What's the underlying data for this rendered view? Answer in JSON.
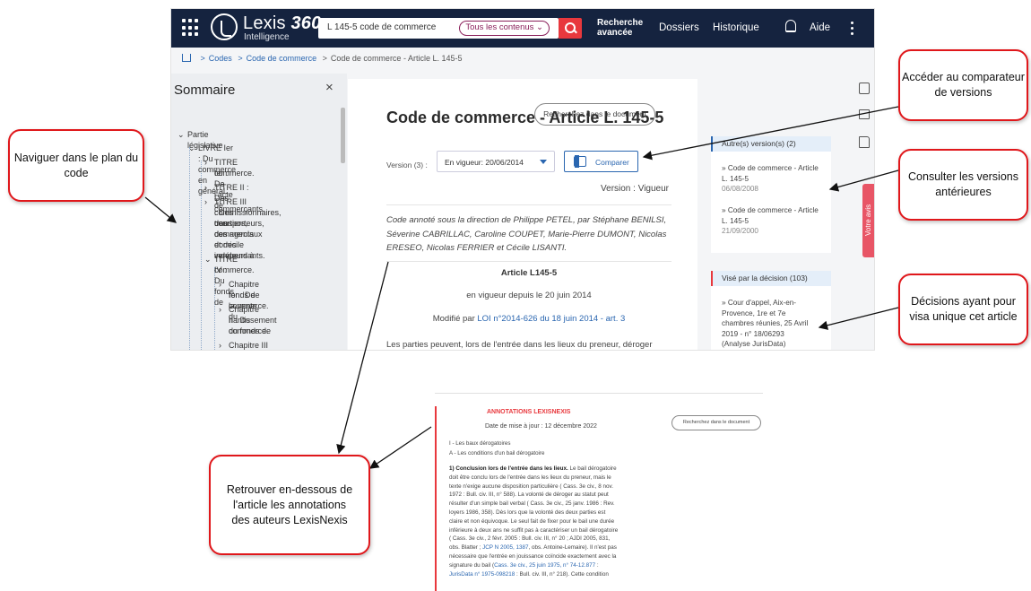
{
  "app": {
    "brand_main": "Lexis",
    "brand_num": "360",
    "brand_sub": "Intelligence",
    "search_query": "L 145-5 code de commerce",
    "scope_label": "Tous les contenus",
    "advanced_label": "Recherche avancée",
    "nav": [
      "Dossiers",
      "Historique",
      "Aide"
    ]
  },
  "breadcrumb": {
    "items": [
      "Codes",
      "Code de commerce",
      "Code de commerce - Article L. 145-5"
    ]
  },
  "sidebar": {
    "title": "Sommaire",
    "close": "×",
    "tree": [
      "Partie législative",
      "LIVRE Ier : Du commerce en général.",
      "TITRE Ier : De l'acte de",
      "commerce.",
      "TITRE II : Des commerçants.",
      "TITRE III : Des courtiers, des",
      "commissionnaires, des",
      "transporteurs, des agents",
      "commerciaux et des vendeurs à",
      "domicile indépendants.",
      "TITRE IV : Du fonds de",
      "commerce.",
      "Chapitre Ier : De la vente du",
      "fonds de commerce.",
      "Chapitre II : Du",
      "nantissement du fonds de",
      "commerce.",
      "Chapitre III : Dispositions"
    ]
  },
  "document": {
    "title": "Code de commerce - Article L. 145-5",
    "version_label": "Version (3) :",
    "version_selected": "En vigueur: 20/06/2014",
    "compare_label": "Comparer",
    "version_status": "Version : Vigueur",
    "authors": "Code annoté sous la direction de Philippe PETEL, par Stéphane BENILSI, Séverine CABRILLAC, Caroline COUPET, Marie-Pierre DUMONT, Nicolas ERESEO, Nicolas FERRIER et Cécile LISANTI.",
    "article_title": "Article L145-5",
    "in_force": "en vigueur depuis le 20 juin 2014",
    "modified_prefix": "Modifié par",
    "modified_link": "LOI n°2014-626 du 18 juin 2014 - art. 3",
    "body_start": "Les parties peuvent, lors de l'entrée dans les lieux du preneur, déroger",
    "search_placeholder": "Recherchez dans le document"
  },
  "versions_panel": {
    "header": "Autre(s) version(s) (2)",
    "items": [
      {
        "line1": "» Code de commerce - Article",
        "line2": "L. 145-5",
        "date": "06/08/2008"
      },
      {
        "line1": "» Code de commerce - Article",
        "line2": "L. 145-5",
        "date": "21/09/2000"
      }
    ]
  },
  "decision_panel": {
    "header": "Visé par la décision (103)",
    "lines": [
      "» Cour d'appel, Aix-en-",
      "Provence, 1re et 7e",
      "chambres réunies, 25 Avril",
      "2019 - n° 18/06293",
      "(Analyse JurisData)"
    ]
  },
  "feedback": "Votre avis",
  "annotations": {
    "header": "ANNOTATIONS LEXISNEXIS",
    "date": "Date de mise à jour : 12 décembre 2022",
    "search": "Recherchez dans le document",
    "l1": "I - Les baux dérogatoires",
    "l2": "A - Les conditions d'un bail dérogatoire",
    "p_bold": "1) Conclusion lors de l'entrée dans les lieux.",
    "p_lines": [
      "Le bail dérogatoire",
      "doit être conclu lors de l'entrée dans les lieux du preneur, mais le",
      "texte n'exige aucune disposition particulière ( Cass. 3e civ., 8 nov.",
      "1972 : Bull. civ. III, n° 588). La volonté de déroger au statut peut",
      "résulter d'un simple bail verbal ( Cass. 3e civ., 25 janv. 1986 : Rev.",
      "loyers 1986, 358). Dès lors que la volonté des deux parties est",
      "claire et non équivoque. Le seul fait de fixer pour le bail une durée",
      "inférieure à deux ans ne suffit pas à caractériser un bail dérogatoire",
      "( Cass. 3e civ., 2 févr. 2005 : Bull. civ. III, n° 20 ; AJDI 2005, 831,",
      "obs. Blatter ;",
      "JCP N 2005, 1387",
      ", obs. Antoine-Lemaire). Il n'est pas",
      "nécessaire que l'entrée en jouissance coïncide exactement avec la",
      "signature du bail (",
      "Cass. 3e civ., 25 juin 1975, n° 74-12.877",
      " :",
      "JurisData n° 1975-098218",
      " : Bull. civ. III, n° 218). Cette condition"
    ]
  },
  "callouts": {
    "nav_plan": "Naviguer dans le plan du code",
    "comparator": "Accéder au comparateur de versions",
    "previous": "Consulter les versions antérieures",
    "decisions": "Décisions ayant pour visa unique cet article",
    "annotations": "Retrouver en-dessous de l'article les annotations des auteurs LexisNexis"
  },
  "colors": {
    "topbar": "#15233f",
    "accent_red": "#e8383d",
    "link_blue": "#2a66b0",
    "callout_border": "#e0171b"
  }
}
